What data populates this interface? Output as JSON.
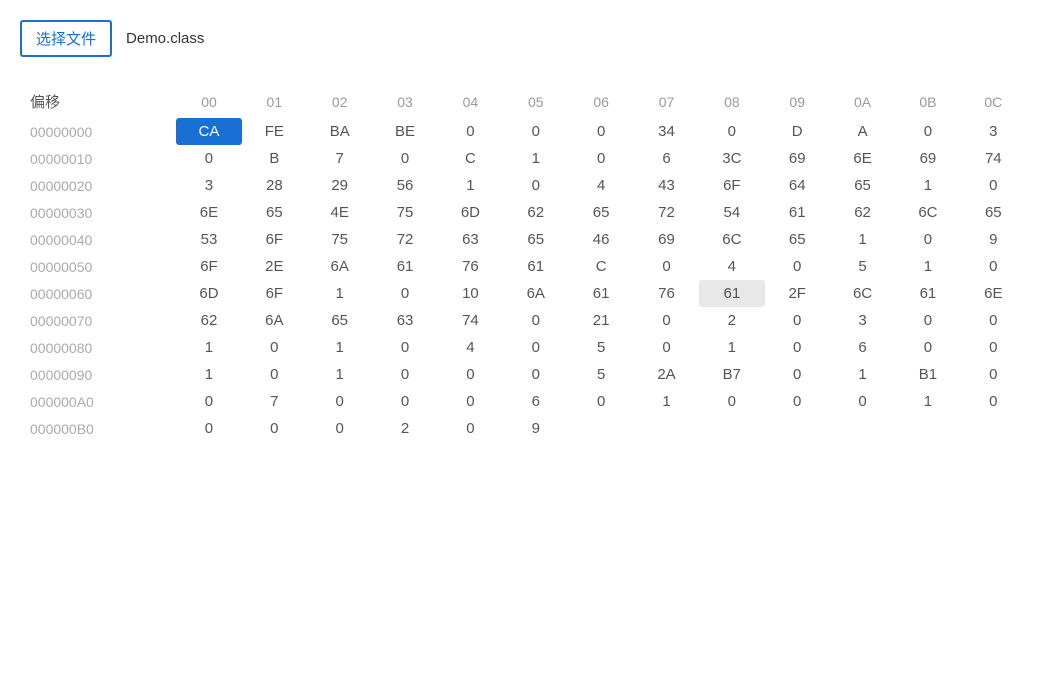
{
  "topbar": {
    "button_label": "选择文件",
    "file_name": "Demo.class"
  },
  "table": {
    "headers": [
      "偏移",
      "00",
      "01",
      "02",
      "03",
      "04",
      "05",
      "06",
      "07",
      "08",
      "09",
      "0A",
      "0B",
      "0C"
    ],
    "rows": [
      {
        "offset": "00000000",
        "cells": [
          "CA",
          "FE",
          "BA",
          "BE",
          "0",
          "0",
          "0",
          "34",
          "0",
          "D",
          "A",
          "0",
          "3"
        ],
        "highlighted": [
          0
        ],
        "selected_light": []
      },
      {
        "offset": "00000010",
        "cells": [
          "0",
          "B",
          "7",
          "0",
          "C",
          "1",
          "0",
          "6",
          "3C",
          "69",
          "6E",
          "69",
          "74"
        ],
        "highlighted": [],
        "selected_light": []
      },
      {
        "offset": "00000020",
        "cells": [
          "3",
          "28",
          "29",
          "56",
          "1",
          "0",
          "4",
          "43",
          "6F",
          "64",
          "65",
          "1",
          "0"
        ],
        "highlighted": [],
        "selected_light": []
      },
      {
        "offset": "00000030",
        "cells": [
          "6E",
          "65",
          "4E",
          "75",
          "6D",
          "62",
          "65",
          "72",
          "54",
          "61",
          "62",
          "6C",
          "65"
        ],
        "highlighted": [],
        "selected_light": []
      },
      {
        "offset": "00000040",
        "cells": [
          "53",
          "6F",
          "75",
          "72",
          "63",
          "65",
          "46",
          "69",
          "6C",
          "65",
          "1",
          "0",
          "9"
        ],
        "highlighted": [],
        "selected_light": []
      },
      {
        "offset": "00000050",
        "cells": [
          "6F",
          "2E",
          "6A",
          "61",
          "76",
          "61",
          "C",
          "0",
          "4",
          "0",
          "5",
          "1",
          "0"
        ],
        "highlighted": [],
        "selected_light": []
      },
      {
        "offset": "00000060",
        "cells": [
          "6D",
          "6F",
          "1",
          "0",
          "10",
          "6A",
          "61",
          "76",
          "61",
          "2F",
          "6C",
          "61",
          "6E"
        ],
        "highlighted": [],
        "selected_light": [
          8
        ]
      },
      {
        "offset": "00000070",
        "cells": [
          "62",
          "6A",
          "65",
          "63",
          "74",
          "0",
          "21",
          "0",
          "2",
          "0",
          "3",
          "0",
          "0"
        ],
        "highlighted": [],
        "selected_light": []
      },
      {
        "offset": "00000080",
        "cells": [
          "1",
          "0",
          "1",
          "0",
          "4",
          "0",
          "5",
          "0",
          "1",
          "0",
          "6",
          "0",
          "0"
        ],
        "highlighted": [],
        "selected_light": []
      },
      {
        "offset": "00000090",
        "cells": [
          "1",
          "0",
          "1",
          "0",
          "0",
          "0",
          "5",
          "2A",
          "B7",
          "0",
          "1",
          "B1",
          "0"
        ],
        "highlighted": [],
        "selected_light": []
      },
      {
        "offset": "000000A0",
        "cells": [
          "0",
          "7",
          "0",
          "0",
          "0",
          "6",
          "0",
          "1",
          "0",
          "0",
          "0",
          "1",
          "0"
        ],
        "highlighted": [],
        "selected_light": []
      },
      {
        "offset": "000000B0",
        "cells": [
          "0",
          "0",
          "0",
          "2",
          "0",
          "9",
          "",
          "",
          "",
          "",
          "",
          "",
          ""
        ],
        "highlighted": [],
        "selected_light": []
      }
    ]
  }
}
